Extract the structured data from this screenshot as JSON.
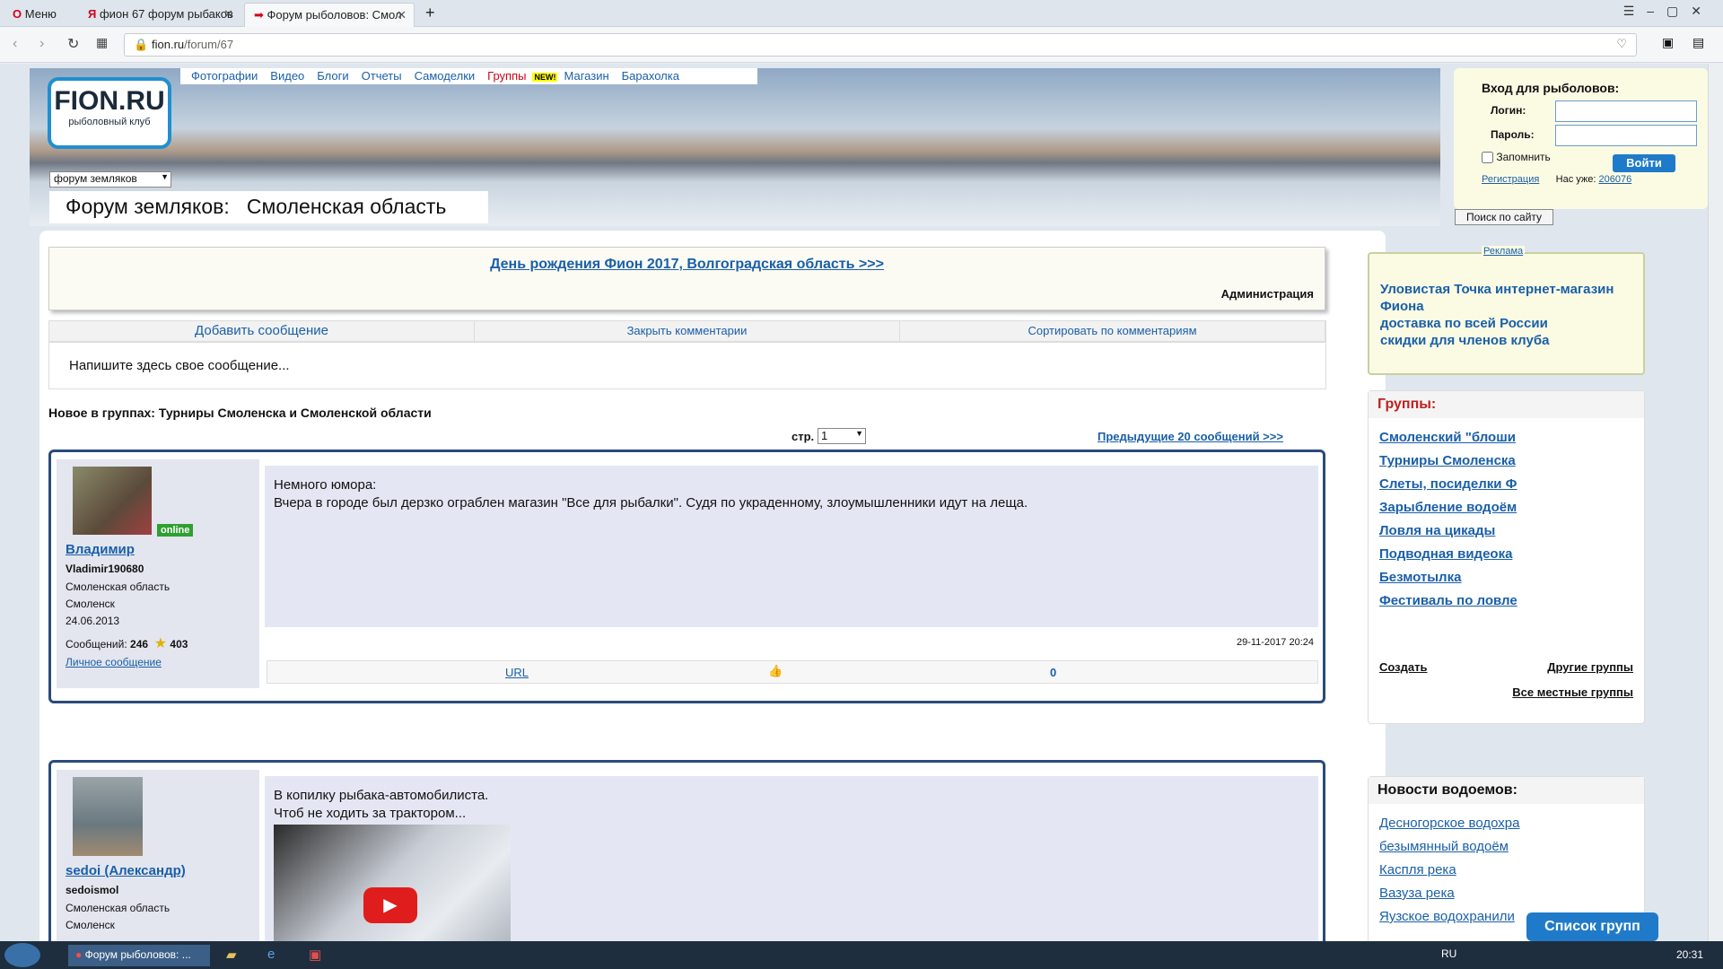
{
  "browser": {
    "menu_label": "Меню",
    "tabs": [
      {
        "title": "фион 67 форум рыбаков"
      },
      {
        "title": "Форум рыболовов: Смол"
      }
    ],
    "new_tab": "+",
    "url_host": "fion.ru",
    "url_path": "/forum/67"
  },
  "site": {
    "logo_text": "FION.RU",
    "logo_sub": "рыболовный клуб",
    "nav": [
      "Фотографии",
      "Видео",
      "Блоги",
      "Отчеты",
      "Самоделки",
      "Группы",
      "Магазин",
      "Барахолка"
    ],
    "nav_new_badge": "NEW!",
    "forum_select": "форум земляков",
    "forum_title_prefix": "Форум земляков:",
    "forum_title_region": "Смоленская область"
  },
  "login": {
    "title": "Вход для рыболовов:",
    "login_label": "Логин:",
    "password_label": "Пароль:",
    "remember_label": "Запомнить",
    "submit_label": "Войти",
    "register_link": "Регистрация",
    "members_label": "Нас уже:",
    "members_count": "206076"
  },
  "search_site_label": "Поиск по сайту",
  "announcement": {
    "link": "День рождения Фион 2017, Волгоградская область >>>",
    "author": "Администрация"
  },
  "actions": {
    "add": "Добавить сообщение",
    "close_comments": "Закрыть комментарии",
    "sort_comments": "Сортировать по комментариям"
  },
  "message_placeholder": "Напишите здесь свое сообщение...",
  "group_ticker": "Новое в группах: Турниры Смоленска и Смоленской области",
  "pager": {
    "page_label": "стр.",
    "page_value": "1",
    "prev_link": "Предыдущие 20 сообщений >>>"
  },
  "posts": [
    {
      "online": "online",
      "name": "Владимир",
      "login": "Vladimir190680",
      "region": "Смоленская область",
      "city": "Смоленск",
      "date": "24.06.2013",
      "messages_label": "Сообщений:",
      "messages": "246",
      "rating": "403",
      "pm_link": "Личное сообщение",
      "text1": "Немного юмора:",
      "text2": "Вчера в городе был дерзко ограблен магазин \"Все для рыбалки\". Судя по украденному, злоумышленники идут на леща.",
      "timestamp": "29-11-2017 20:24",
      "url_label": "URL",
      "likes": "0"
    },
    {
      "name": "sedoi (Александр)",
      "login": "sedoismol",
      "region": "Смоленская область",
      "city": "Смоленск",
      "text1": "В копилку рыбака-автомобилиста.",
      "text2": "Чтоб не ходить за трактором..."
    }
  ],
  "sidebar": {
    "ad_label": "Реклама",
    "ad_lines": [
      "Уловистая Точка интернет-магазин Фиона",
      "доставка по всей России",
      "скидки для членов клуба"
    ],
    "groups_title": "Группы:",
    "groups": [
      "Смоленский \"блоши",
      "Турниры Смоленска",
      "Слеты, посиделки Ф",
      "Зарыбление водоём",
      "Ловля на цикады",
      "Подводная видеока",
      "Безмотылка",
      "Фестиваль по ловле"
    ],
    "create": "Создать",
    "other_groups": "Другие группы",
    "all_local_groups": "Все местные группы",
    "news_title": "Новости водоемов:",
    "news": [
      "Десногорское водохра",
      "безымянный водоём",
      "Каспля река",
      "Вазуза река",
      "Яузское водохранили"
    ]
  },
  "floating_button": "Список групп",
  "taskbar": {
    "task": "Форум рыболовов: ...",
    "lang": "RU",
    "clock": "20:31"
  },
  "colors": {
    "accent": "#1f7bc9",
    "link": "#1a5fa8",
    "groups_title": "#c02020",
    "post_border": "#2a4a7a"
  }
}
